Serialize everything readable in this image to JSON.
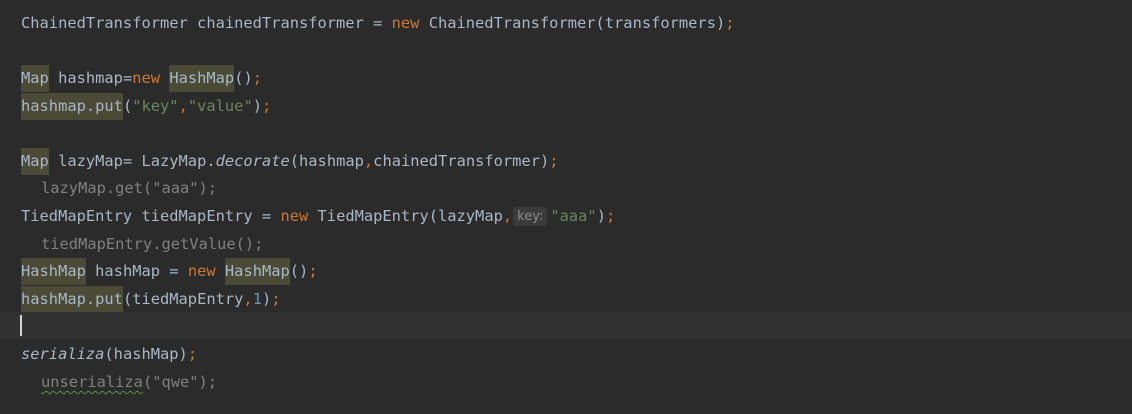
{
  "editor": {
    "fragment_top": "};",
    "lines": [
      {
        "t1": "ChainedTransformer chainedTransformer = ",
        "kw": "new",
        "t2": " ChainedTransformer(transformers)",
        "semi": ";"
      },
      {
        "hl1": "Map",
        "t1": " hashmap=",
        "kw": "new",
        "sp": " ",
        "hl2": "HashMap",
        "t2": "()",
        "semi": ";"
      },
      {
        "hl1": "hashmap.put",
        "t1": "(",
        "s1": "\"key\"",
        "comma": ",",
        "s2": "\"value\"",
        "t2": ")",
        "semi": ";"
      },
      {
        "hl1": "Map",
        "t1": " lazyMap= LazyMap.",
        "ital": "decorate",
        "t2": "(hashmap",
        "comma": ",",
        "t3": "chainedTransformer)",
        "semi": ";"
      },
      {
        "text": "lazyMap.get(\"aaa\");"
      },
      {
        "t1": "TiedMapEntry tiedMapEntry = ",
        "kw": "new",
        "t2": " TiedMapEntry(lazyMap",
        "comma": ",",
        "hint": "key:",
        "s1": "\"aaa\"",
        "t3": ")",
        "semi": ";"
      },
      {
        "text": "tiedMapEntry.getValue();"
      },
      {
        "hl1": "HashMap",
        "t1": " hashMap = ",
        "kw": "new",
        "sp": " ",
        "hl2": "HashMap",
        "t2": "()",
        "semi": ";"
      },
      {
        "hl1": "hashMap.put",
        "t1": "(tiedMapEntry",
        "comma": ",",
        "num": "1",
        "t2": ")",
        "semi": ";"
      },
      {
        "ital": "serializa",
        "t1": "(hashMap)",
        "semi": ";"
      },
      {
        "squiggle": "unserializa",
        "text": "(\"qwe\");"
      }
    ]
  }
}
